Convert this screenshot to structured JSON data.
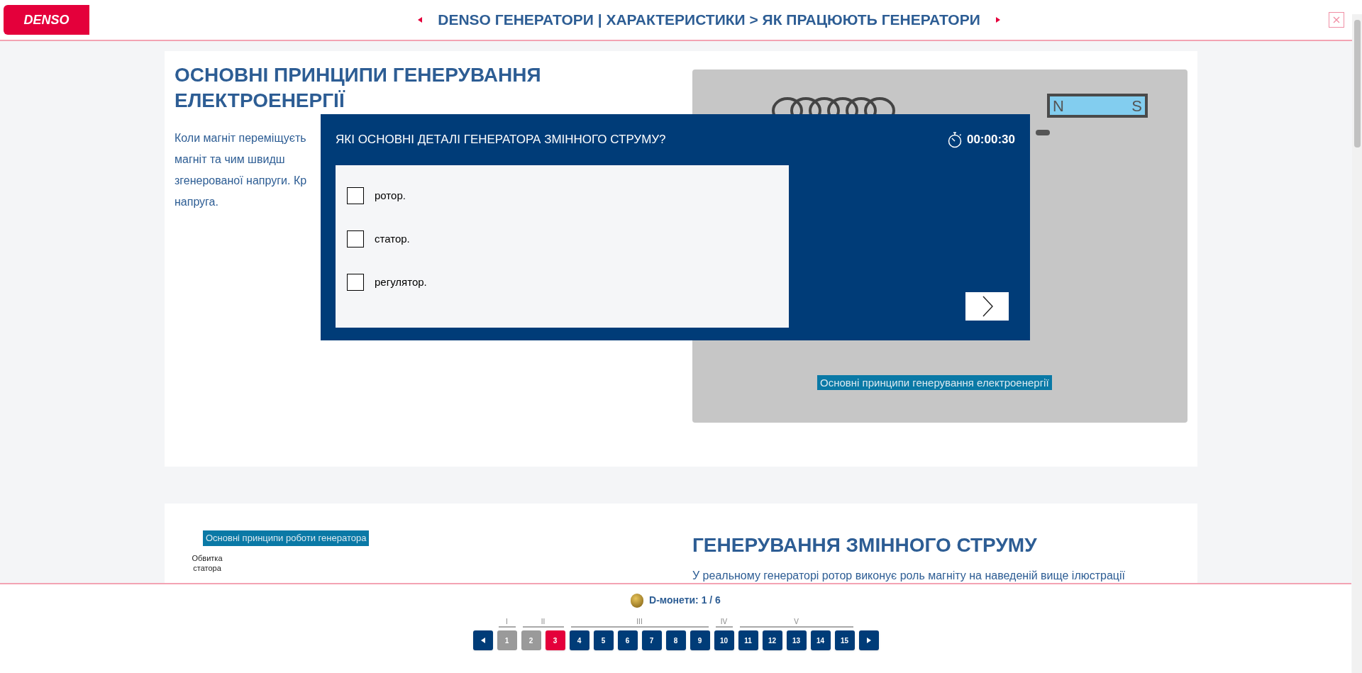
{
  "header": {
    "logo": "DENSO",
    "breadcrumb": "DENSO ГЕНЕРАТОРИ | ХАРАКТЕРИСТИКИ > ЯК ПРАЦЮЮТЬ ГЕНЕРАТОРИ"
  },
  "section_1": {
    "heading_lines": [
      "ОСНОВНІ ПРИНЦИПИ ГЕНЕРУВАННЯ",
      "ЕЛЕКТРОЕНЕРГІЇ"
    ],
    "paragraph_lines": [
      "Коли магніт переміщуєть",
      "магніт та чим швидш",
      "згенерованої напруги. Кр",
      "напруга."
    ],
    "figure": {
      "magnet_poles": [
        "N",
        "S"
      ],
      "caption": "Основні принципи генерування електроенергії"
    }
  },
  "section_2": {
    "figure_caption": "Основні принципи роботи генератора",
    "callout": "Обвитка статора",
    "heading": "ГЕНЕРУВАННЯ ЗМІННОГО СТРУМУ",
    "paragraph": "У реальному генераторі ротор виконує роль магніту на наведеній вище ілюстрації"
  },
  "quiz": {
    "question": "ЯКІ ОСНОВНІ ДЕТАЛІ ГЕНЕРАТОРА ЗМІННОГО СТРУМУ?",
    "timer": "00:00:30",
    "options": [
      {
        "label": "ротор.",
        "checked": false
      },
      {
        "label": "статор.",
        "checked": false
      },
      {
        "label": "регулятор.",
        "checked": false
      }
    ]
  },
  "footer": {
    "coins": "D-монети: 1 / 6",
    "groups": [
      {
        "label": "I",
        "pages": [
          {
            "label": "1",
            "visited": true,
            "selected": false
          }
        ]
      },
      {
        "label": "II",
        "pages": [
          {
            "label": "2",
            "visited": true,
            "selected": false
          },
          {
            "label": "3",
            "visited": false,
            "selected": true
          }
        ]
      },
      {
        "label": "III",
        "pages": [
          {
            "label": "4",
            "visited": false,
            "selected": false
          },
          {
            "label": "5",
            "visited": false,
            "selected": false
          },
          {
            "label": "6",
            "visited": false,
            "selected": false
          },
          {
            "label": "7",
            "visited": false,
            "selected": false
          },
          {
            "label": "8",
            "visited": false,
            "selected": false
          },
          {
            "label": "9",
            "visited": false,
            "selected": false
          }
        ]
      },
      {
        "label": "IV",
        "pages": [
          {
            "label": "10",
            "visited": false,
            "selected": false
          }
        ]
      },
      {
        "label": "V",
        "pages": [
          {
            "label": "11",
            "visited": false,
            "selected": false
          },
          {
            "label": "12",
            "visited": false,
            "selected": false
          },
          {
            "label": "13",
            "visited": false,
            "selected": false
          },
          {
            "label": "14",
            "visited": false,
            "selected": false
          },
          {
            "label": "15",
            "visited": false,
            "selected": false
          }
        ]
      }
    ]
  }
}
